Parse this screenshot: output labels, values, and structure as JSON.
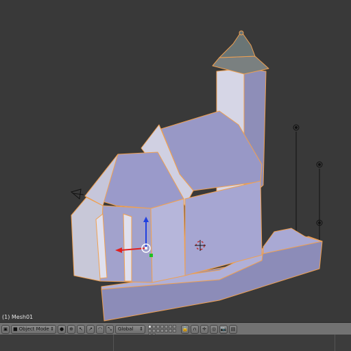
{
  "viewport": {
    "object_label": "(1) Mesh01"
  },
  "header": {
    "mode_label": "Object Mode",
    "orientation_label": "Global"
  },
  "colors": {
    "background": "#393939",
    "mesh_face": "#9c9cc9",
    "selected_outline": "#f0a050",
    "header_bar": "#727272"
  },
  "icons": [
    "view3d-editor-icon",
    "shading-icon",
    "pivot-icon",
    "manipulator-icon",
    "translate-icon",
    "rotate-icon",
    "scale-icon",
    "layers-grid",
    "lock-icon",
    "snap-icon",
    "proportional-icon",
    "render-icon"
  ]
}
